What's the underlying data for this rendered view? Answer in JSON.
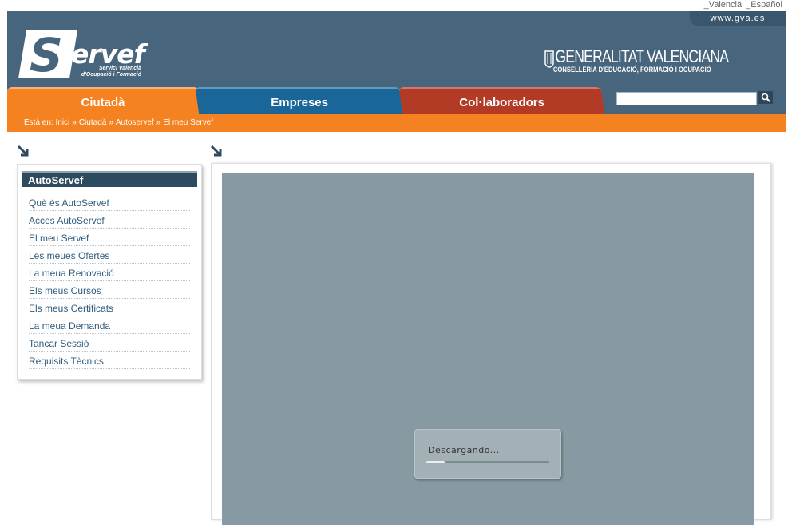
{
  "language_links": [
    "_Valencià",
    "_Español"
  ],
  "header": {
    "gva_link": "www.gva.es",
    "logo_text": "ervef",
    "logo_letter": "S",
    "logo_subtitle_1": "Servici Valencià",
    "logo_subtitle_2": "d'Ocupació i Formació",
    "gv_title": "GENERALITAT VALENCIANA",
    "gv_subtitle": "CONSELLERIA D'EDUCACIÓ, FORMACIÓ I OCUPACIÓ"
  },
  "tabs": [
    {
      "label": "Ciutadà",
      "color": "#f58220"
    },
    {
      "label": "Empreses",
      "color": "#1a6699"
    },
    {
      "label": "Col·laboradors",
      "color": "#b23b25"
    }
  ],
  "search": {
    "value": "",
    "icon": "search-icon"
  },
  "breadcrumb": {
    "prefix": "Està en:",
    "items": [
      "Inici",
      "Ciutadà",
      "Autoservef",
      "El meu Servef"
    ],
    "separator": "»"
  },
  "sidebar": {
    "title": "AutoServef",
    "items": [
      "Què és AutoServef",
      "Acces AutoServef",
      "El meu Servef",
      "Les meues Ofertes",
      "La meua Renovació",
      "Els meus Cursos",
      "Els meus Certificats",
      "La meua Demanda",
      "Tancar Sessió",
      "Requisits Tècnics"
    ]
  },
  "loader": {
    "text": "Descargando...",
    "progress": 0.15
  },
  "colors": {
    "header": "#47657d",
    "orange": "#f58220",
    "frame": "#879aa3"
  }
}
